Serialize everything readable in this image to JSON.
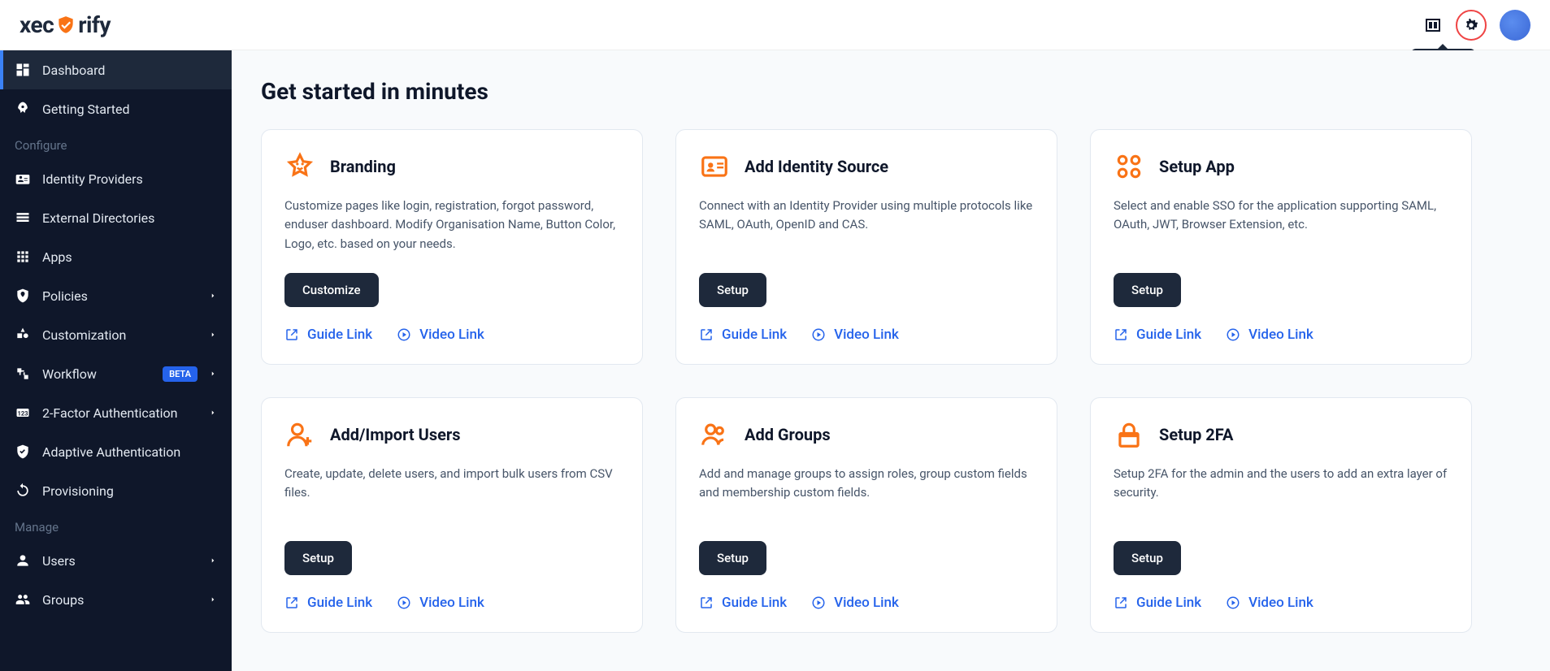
{
  "brand": {
    "name_part1": "xec",
    "name_part2": "rify"
  },
  "header": {
    "tooltip": "Settings"
  },
  "sidebar": {
    "items": [
      {
        "label": "Dashboard",
        "icon": "dashboard-icon",
        "active": true
      },
      {
        "label": "Getting Started",
        "icon": "rocket-icon"
      }
    ],
    "section_configure": "Configure",
    "configure": [
      {
        "label": "Identity Providers",
        "icon": "id-icon"
      },
      {
        "label": "External Directories",
        "icon": "list-icon"
      },
      {
        "label": "Apps",
        "icon": "grid-icon"
      },
      {
        "label": "Policies",
        "icon": "policy-icon",
        "chevron": true
      },
      {
        "label": "Customization",
        "icon": "custom-icon",
        "chevron": true
      },
      {
        "label": "Workflow",
        "icon": "workflow-icon",
        "chevron": true,
        "badge": "BETA"
      },
      {
        "label": "2-Factor Authentication",
        "icon": "tfa-icon",
        "chevron": true
      },
      {
        "label": "Adaptive Authentication",
        "icon": "shield-icon"
      },
      {
        "label": "Provisioning",
        "icon": "sync-icon"
      }
    ],
    "section_manage": "Manage",
    "manage": [
      {
        "label": "Users",
        "icon": "user-icon",
        "chevron": true
      },
      {
        "label": "Groups",
        "icon": "groups-icon",
        "chevron": true
      }
    ]
  },
  "main": {
    "title": "Get started in minutes",
    "guide_label": "Guide Link",
    "video_label": "Video Link",
    "cards": [
      {
        "title": "Branding",
        "desc": "Customize pages like login, registration, forgot password, enduser dashboard. Modify Organisation Name, Button Color, Logo, etc. based on your needs.",
        "btn": "Customize",
        "icon": "star"
      },
      {
        "title": "Add Identity Source",
        "desc": "Connect with an Identity Provider using multiple protocols like SAML, OAuth, OpenID and CAS.",
        "btn": "Setup",
        "icon": "idcard"
      },
      {
        "title": "Setup App",
        "desc": "Select and enable SSO for the application supporting SAML, OAuth, JWT, Browser Extension, etc.",
        "btn": "Setup",
        "icon": "apps"
      },
      {
        "title": "Add/Import Users",
        "desc": "Create, update, delete users, and import bulk users from CSV files.",
        "btn": "Setup",
        "icon": "useradd"
      },
      {
        "title": "Add Groups",
        "desc": "Add and manage groups to assign roles, group custom fields and membership custom fields.",
        "btn": "Setup",
        "icon": "group"
      },
      {
        "title": "Setup 2FA",
        "desc": "Setup 2FA for the admin and the users to add an extra layer of security.",
        "btn": "Setup",
        "icon": "lock"
      }
    ]
  }
}
